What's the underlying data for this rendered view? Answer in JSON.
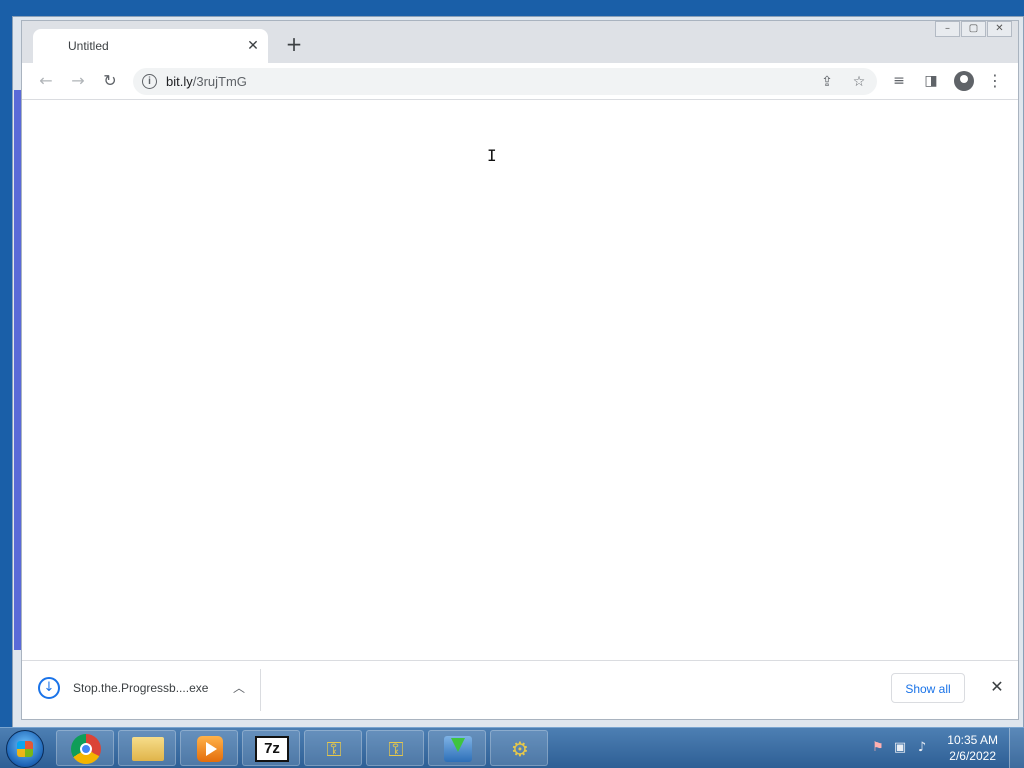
{
  "desktop": {
    "background_color": "#1a5fa8"
  },
  "browser": {
    "tab": {
      "title": "Untitled",
      "close_glyph": "✕"
    },
    "new_tab_glyph": "+",
    "window_controls": [
      "–",
      "▢",
      "✕"
    ],
    "toolbar": {
      "back_icon": "arrow-left-icon",
      "forward_icon": "arrow-right-icon",
      "reload_icon": "reload-icon",
      "url_host": "bit.ly",
      "url_path": "/3rujTmG",
      "share_icon": "share-icon",
      "bookmark_icon": "star-icon",
      "reading_list_icon": "reading-list-icon",
      "side_panel_icon": "side-panel-icon",
      "profile_icon": "profile-icon",
      "menu_icon": "kebab-menu-icon"
    },
    "download_shelf": {
      "file_name": "Stop.the.Progressb....exe",
      "show_all_label": "Show all"
    }
  },
  "taskbar": {
    "apps": [
      "Google Chrome",
      "Windows Explorer",
      "Media Player",
      "7-Zip",
      "Key tool",
      "Key tool",
      "Installer",
      "Network setup"
    ],
    "sevenzip_label": "7z",
    "clock": {
      "time": "10:35 AM",
      "date": "2/6/2022"
    }
  },
  "colors": {
    "accent": "#1a73e8",
    "taskbar": "#2e5f95"
  }
}
